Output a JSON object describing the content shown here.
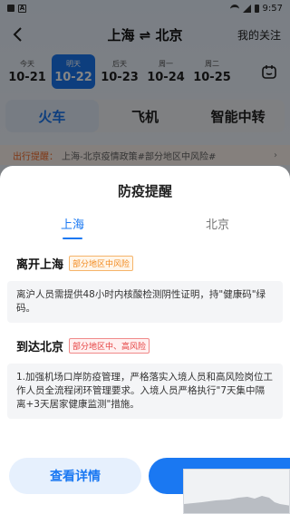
{
  "status_bar": {
    "time": "9:57"
  },
  "header": {
    "route": "上海 ⇌ 北京",
    "follow": "我的关注"
  },
  "dates": [
    {
      "weekday": "今天",
      "date": "10-21",
      "active": false
    },
    {
      "weekday": "明天",
      "date": "10-22",
      "active": true
    },
    {
      "weekday": "后天",
      "date": "10-23",
      "active": false
    },
    {
      "weekday": "周一",
      "date": "10-24",
      "active": false
    },
    {
      "weekday": "周二",
      "date": "10-25",
      "active": false
    }
  ],
  "mode_tabs": [
    {
      "label": "火车",
      "active": true
    },
    {
      "label": "飞机",
      "active": false
    },
    {
      "label": "智能中转",
      "active": false
    }
  ],
  "notice": {
    "label": "出行提醒：",
    "text": "上海-北京疫情政策#部分地区中风险#"
  },
  "sheet": {
    "title": "防疫提醒",
    "city_tabs": [
      {
        "label": "上海"
      },
      {
        "label": "北京"
      }
    ],
    "leave": {
      "title": "离开上海",
      "tag": "部分地区中风险",
      "text": "离沪人员需提供48小时内核酸检测阴性证明，持\"健康码\"绿码。"
    },
    "arrive": {
      "title": "到达北京",
      "tag": "部分地区中、高风险",
      "text": "1.加强机场口岸防疫管理，严格落实入境人员和高风险岗位工作人员全流程闭环管理要求。入境人员严格执行\"7天集中隔离+3天居家健康监测\"措施。"
    },
    "detail_button": "查看详情"
  },
  "colors": {
    "accent": "#1a78f2",
    "risk_medium": "#f28a1f",
    "risk_high": "#e54040"
  }
}
